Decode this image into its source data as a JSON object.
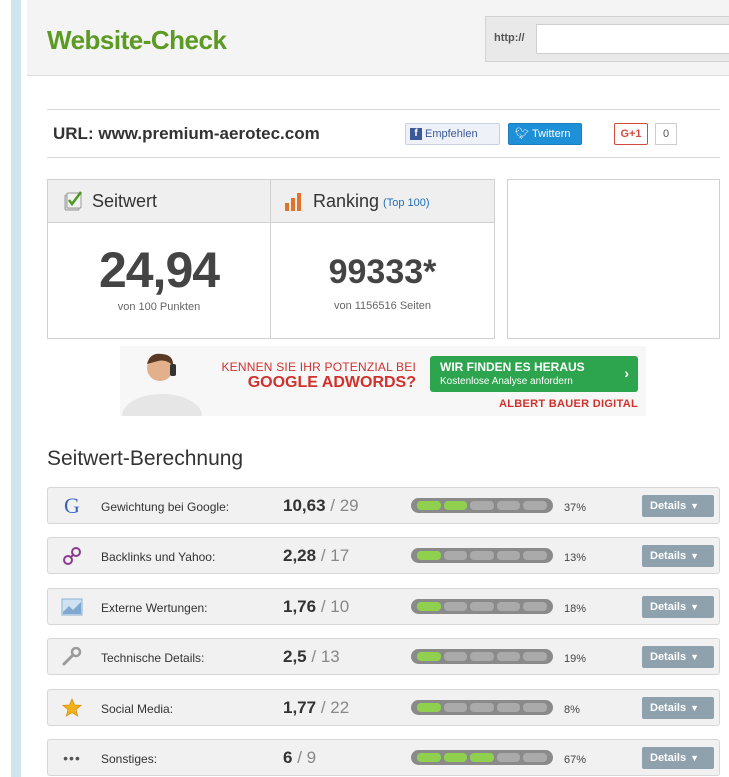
{
  "header": {
    "logo": "Website-Check",
    "url_prefix": "http://",
    "url_input_value": ""
  },
  "url_row": {
    "label": "URL:",
    "domain": "www.premium-aerotec.com",
    "facebook_label": "Empfehlen",
    "twitter_label": "Twittern",
    "gplus_label": "G+1",
    "gplus_count": "0"
  },
  "seitwert": {
    "title": "Seitwert",
    "value": "24,94",
    "sub": "von 100 Punkten"
  },
  "ranking": {
    "title": "Ranking",
    "top": "(Top 100)",
    "value": "99333*",
    "sub": "von 1156516 Seiten"
  },
  "banner": {
    "line1": "KENNEN SIE IHR POTENZIAL BEI",
    "line2": "GOOGLE ADWORDS?",
    "cta_title": "WIR FINDEN ES HERAUS",
    "cta_sub": "Kostenlose Analyse anfordern",
    "brand": "ALBERT BAUER DIGITAL"
  },
  "calculation": {
    "title": "Seitwert-Berechnung",
    "details_label": "Details",
    "rows": [
      {
        "label": "Gewichtung bei Google:",
        "score": "10,63",
        "max": "/ 29",
        "percent": "37%",
        "percent_value": 37,
        "icon": "google-icon"
      },
      {
        "label": "Backlinks und Yahoo:",
        "score": "2,28",
        "max": "/ 17",
        "percent": "13%",
        "percent_value": 13,
        "icon": "link-icon"
      },
      {
        "label": "Externe Wertungen:",
        "score": "1,76",
        "max": "/ 10",
        "percent": "18%",
        "percent_value": 18,
        "icon": "chart-image-icon"
      },
      {
        "label": "Technische Details:",
        "score": "2,5",
        "max": "/ 13",
        "percent": "19%",
        "percent_value": 19,
        "icon": "wrench-icon"
      },
      {
        "label": "Social Media:",
        "score": "1,77",
        "max": "/ 22",
        "percent": "8%",
        "percent_value": 8,
        "icon": "star-icon"
      },
      {
        "label": "Sonstiges:",
        "score": "6",
        "max": "/ 9",
        "percent": "67%",
        "percent_value": 67,
        "icon": "dots-icon"
      }
    ]
  },
  "colors": {
    "logo_green": "#5b9a23",
    "bar_green": "#8fd14f",
    "adwords_red": "#d0312d",
    "cta_green": "#2da44e",
    "twitter_blue": "#1e90d8",
    "facebook_blue": "#3b5998"
  }
}
